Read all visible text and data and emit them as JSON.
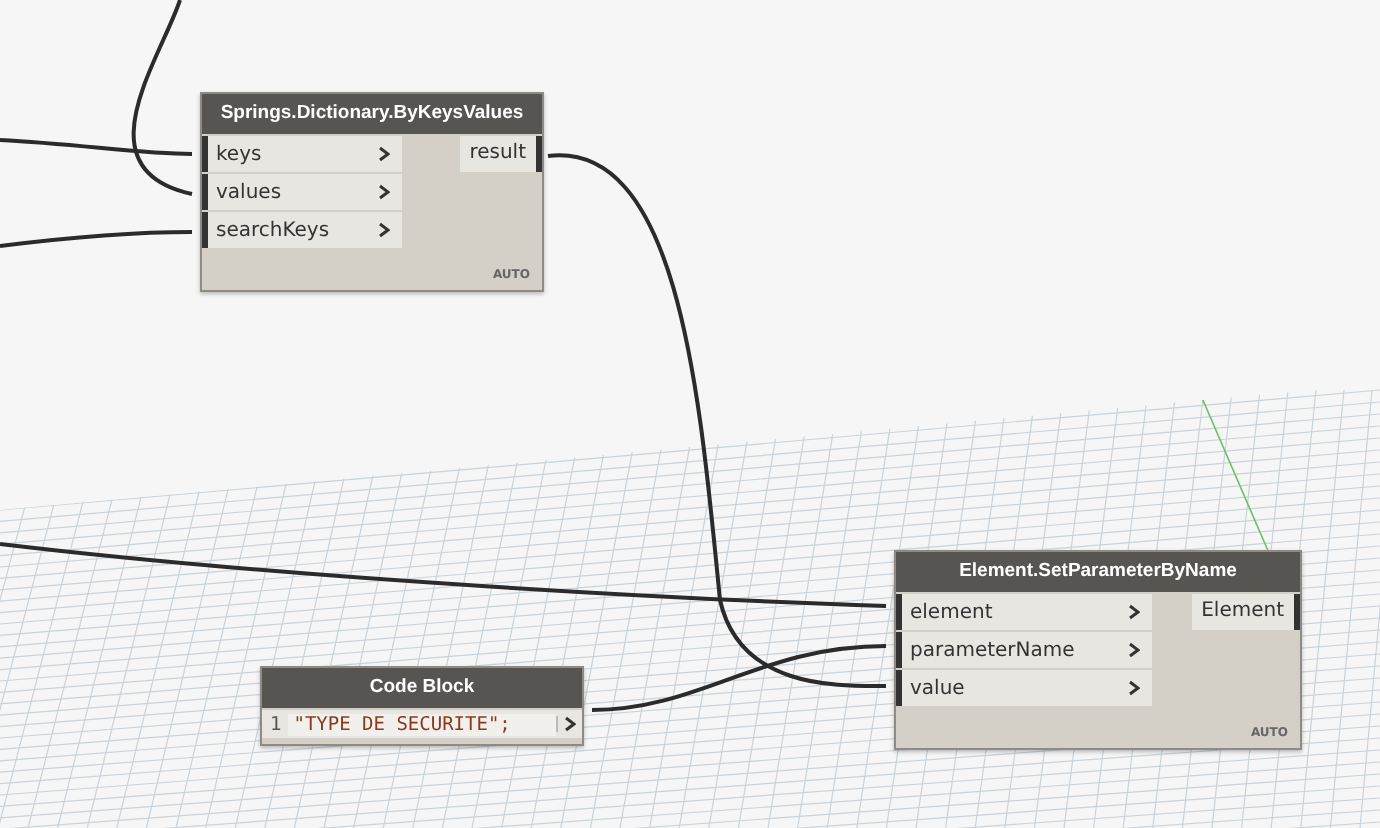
{
  "nodes": [
    {
      "kind": "function",
      "title": "Springs.Dictionary.ByKeysValues",
      "inputs": [
        "keys",
        "values",
        "searchKeys"
      ],
      "outputs": [
        "result"
      ],
      "footer": "AUTO"
    },
    {
      "kind": "code",
      "title": "Code Block",
      "line_number": "1",
      "code": "\"TYPE DE SECURITE\";"
    },
    {
      "kind": "function",
      "title": "Element.SetParameterByName",
      "inputs": [
        "element",
        "parameterName",
        "value"
      ],
      "outputs": [
        "Element"
      ],
      "footer": "AUTO"
    }
  ]
}
